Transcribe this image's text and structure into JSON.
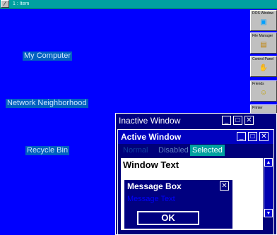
{
  "taskbar": {
    "start_glyph": "⁄",
    "task_label": "1 : Item"
  },
  "dock": {
    "items": [
      {
        "label": "DOS Window",
        "icon": "dos-icon",
        "glyph": "▣"
      },
      {
        "label": "File Manager",
        "icon": "file-manager-icon",
        "glyph": "▤"
      },
      {
        "label": "Control Panel",
        "icon": "control-panel-icon",
        "glyph": "✋"
      },
      {
        "label": "Friends",
        "icon": "smiley-icon",
        "glyph": "☺"
      },
      {
        "label": "Printer",
        "icon": "printer-icon",
        "glyph": "▦"
      }
    ]
  },
  "desktop": {
    "icons": [
      {
        "label": "My Computer"
      },
      {
        "label": "Network Neighborhood"
      },
      {
        "label": "Recycle Bin"
      }
    ]
  },
  "inactive_window": {
    "title": "Inactive Window",
    "min": "_",
    "max": "□",
    "close": "✕"
  },
  "active_window": {
    "title": "Active Window",
    "min": "_",
    "max": "□",
    "close": "✕",
    "menu": {
      "normal": "Normal",
      "disabled": "Disabled",
      "selected": "Selected"
    },
    "window_text": "Window Text",
    "scroll_up": "▲",
    "scroll_down": "▼"
  },
  "message_box": {
    "title": "Message Box",
    "close": "✕",
    "text": "Message Text",
    "ok": "OK"
  },
  "colors": {
    "desktop": "#0000ff",
    "title_active": "#0000c0",
    "title_inactive": "#000080",
    "selected_highlight": "#00a0a0",
    "taskbar": "#00a0a0"
  }
}
